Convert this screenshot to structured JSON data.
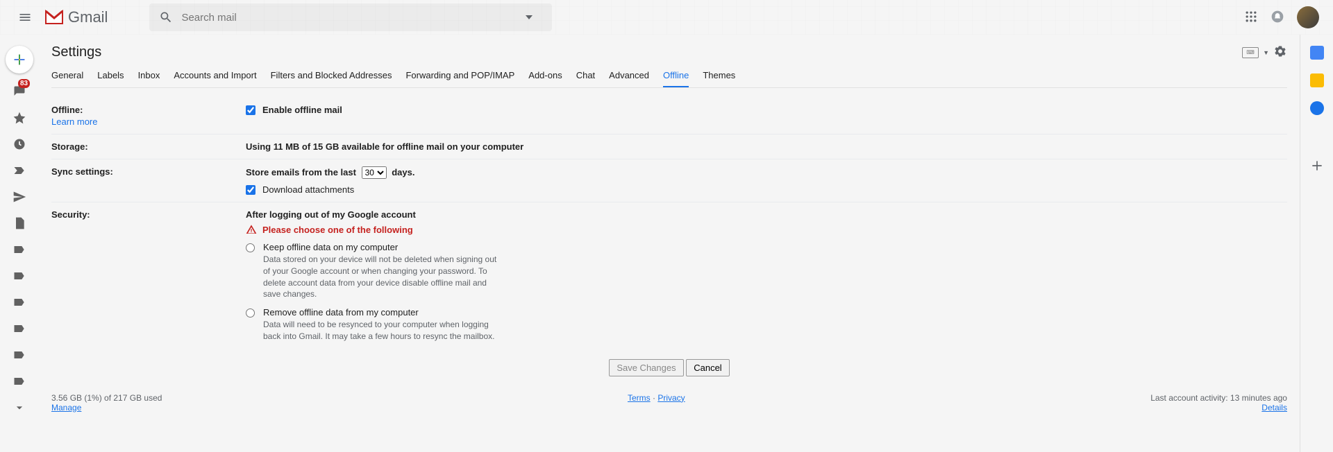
{
  "app": {
    "name": "Gmail"
  },
  "search": {
    "placeholder": "Search mail"
  },
  "leftrail": {
    "inbox_badge": "83"
  },
  "header": {
    "title": "Settings"
  },
  "tabs": {
    "items": [
      "General",
      "Labels",
      "Inbox",
      "Accounts and Import",
      "Filters and Blocked Addresses",
      "Forwarding and POP/IMAP",
      "Add-ons",
      "Chat",
      "Advanced",
      "Offline",
      "Themes"
    ],
    "active": "Offline"
  },
  "settings": {
    "offline": {
      "label": "Offline:",
      "learn_more": "Learn more",
      "enable_label": "Enable offline mail",
      "enable_checked": true
    },
    "storage": {
      "label": "Storage:",
      "text": "Using 11 MB of 15 GB available for offline mail on your computer"
    },
    "sync": {
      "label": "Sync settings:",
      "prefix": "Store emails from the last",
      "selected": "30",
      "suffix": "days.",
      "dl_checked": true,
      "dl_label": "Download attachments"
    },
    "security": {
      "label": "Security:",
      "heading": "After logging out of my Google account",
      "warning": "Please choose one of the following",
      "opt1": {
        "title": "Keep offline data on my computer",
        "desc": "Data stored on your device will not be deleted when signing out of your Google account or when changing your password. To delete account data from your device disable offline mail and save changes."
      },
      "opt2": {
        "title": "Remove offline data from my computer",
        "desc": "Data will need to be resynced to your computer when logging back into Gmail. It may take a few hours to resync the mailbox."
      }
    }
  },
  "buttons": {
    "save": "Save Changes",
    "cancel": "Cancel"
  },
  "footer": {
    "storage": "3.56 GB (1%) of 217 GB used",
    "manage": "Manage",
    "terms": "Terms",
    "sep": " · ",
    "privacy": "Privacy",
    "activity": "Last account activity: 13 minutes ago",
    "details": "Details"
  }
}
